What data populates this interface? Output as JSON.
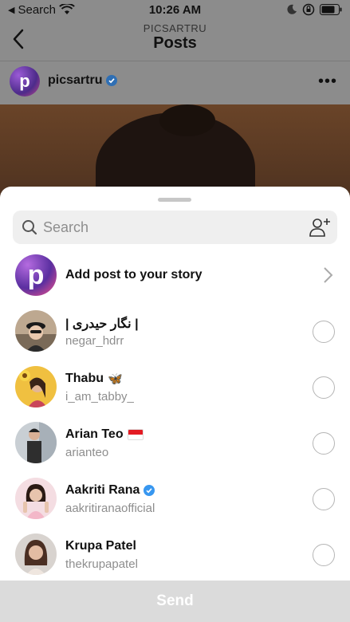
{
  "status_bar": {
    "back_app": "Search",
    "time": "10:26 AM"
  },
  "header": {
    "subtitle": "PICSARTRU",
    "title": "Posts"
  },
  "post": {
    "username": "picsartru",
    "avatar_letter": "p"
  },
  "share_sheet": {
    "search": {
      "placeholder": "Search",
      "value": ""
    },
    "story": {
      "label": "Add post to your story",
      "avatar_letter": "p"
    },
    "people": [
      {
        "name": "| نگار حیدری |",
        "handle": "negar_hdrr",
        "verified": false,
        "flag": false,
        "emoji": ""
      },
      {
        "name": "Thabu",
        "handle": "i_am_tabby_",
        "verified": false,
        "flag": false,
        "emoji": "🦋"
      },
      {
        "name": "Arian Teo",
        "handle": "arianteo",
        "verified": false,
        "flag": true,
        "emoji": ""
      },
      {
        "name": "Aakriti Rana",
        "handle": "aakritiranaofficial",
        "verified": true,
        "flag": false,
        "emoji": ""
      },
      {
        "name": "Krupa Patel",
        "handle": "thekrupapatel",
        "verified": false,
        "flag": false,
        "emoji": ""
      }
    ],
    "send_label": "Send"
  },
  "colors": {
    "verified_blue": "#3897f0",
    "dim_overlay": "#8c8c8c",
    "send_disabled": "#dbdbdb"
  },
  "icons": [
    "back-arrow-icon",
    "wifi-icon",
    "moon-icon",
    "lock-rotation-icon",
    "battery-icon",
    "verified-badge-icon",
    "more-icon",
    "search-icon",
    "add-people-icon",
    "chevron-right-icon",
    "radio-icon"
  ]
}
